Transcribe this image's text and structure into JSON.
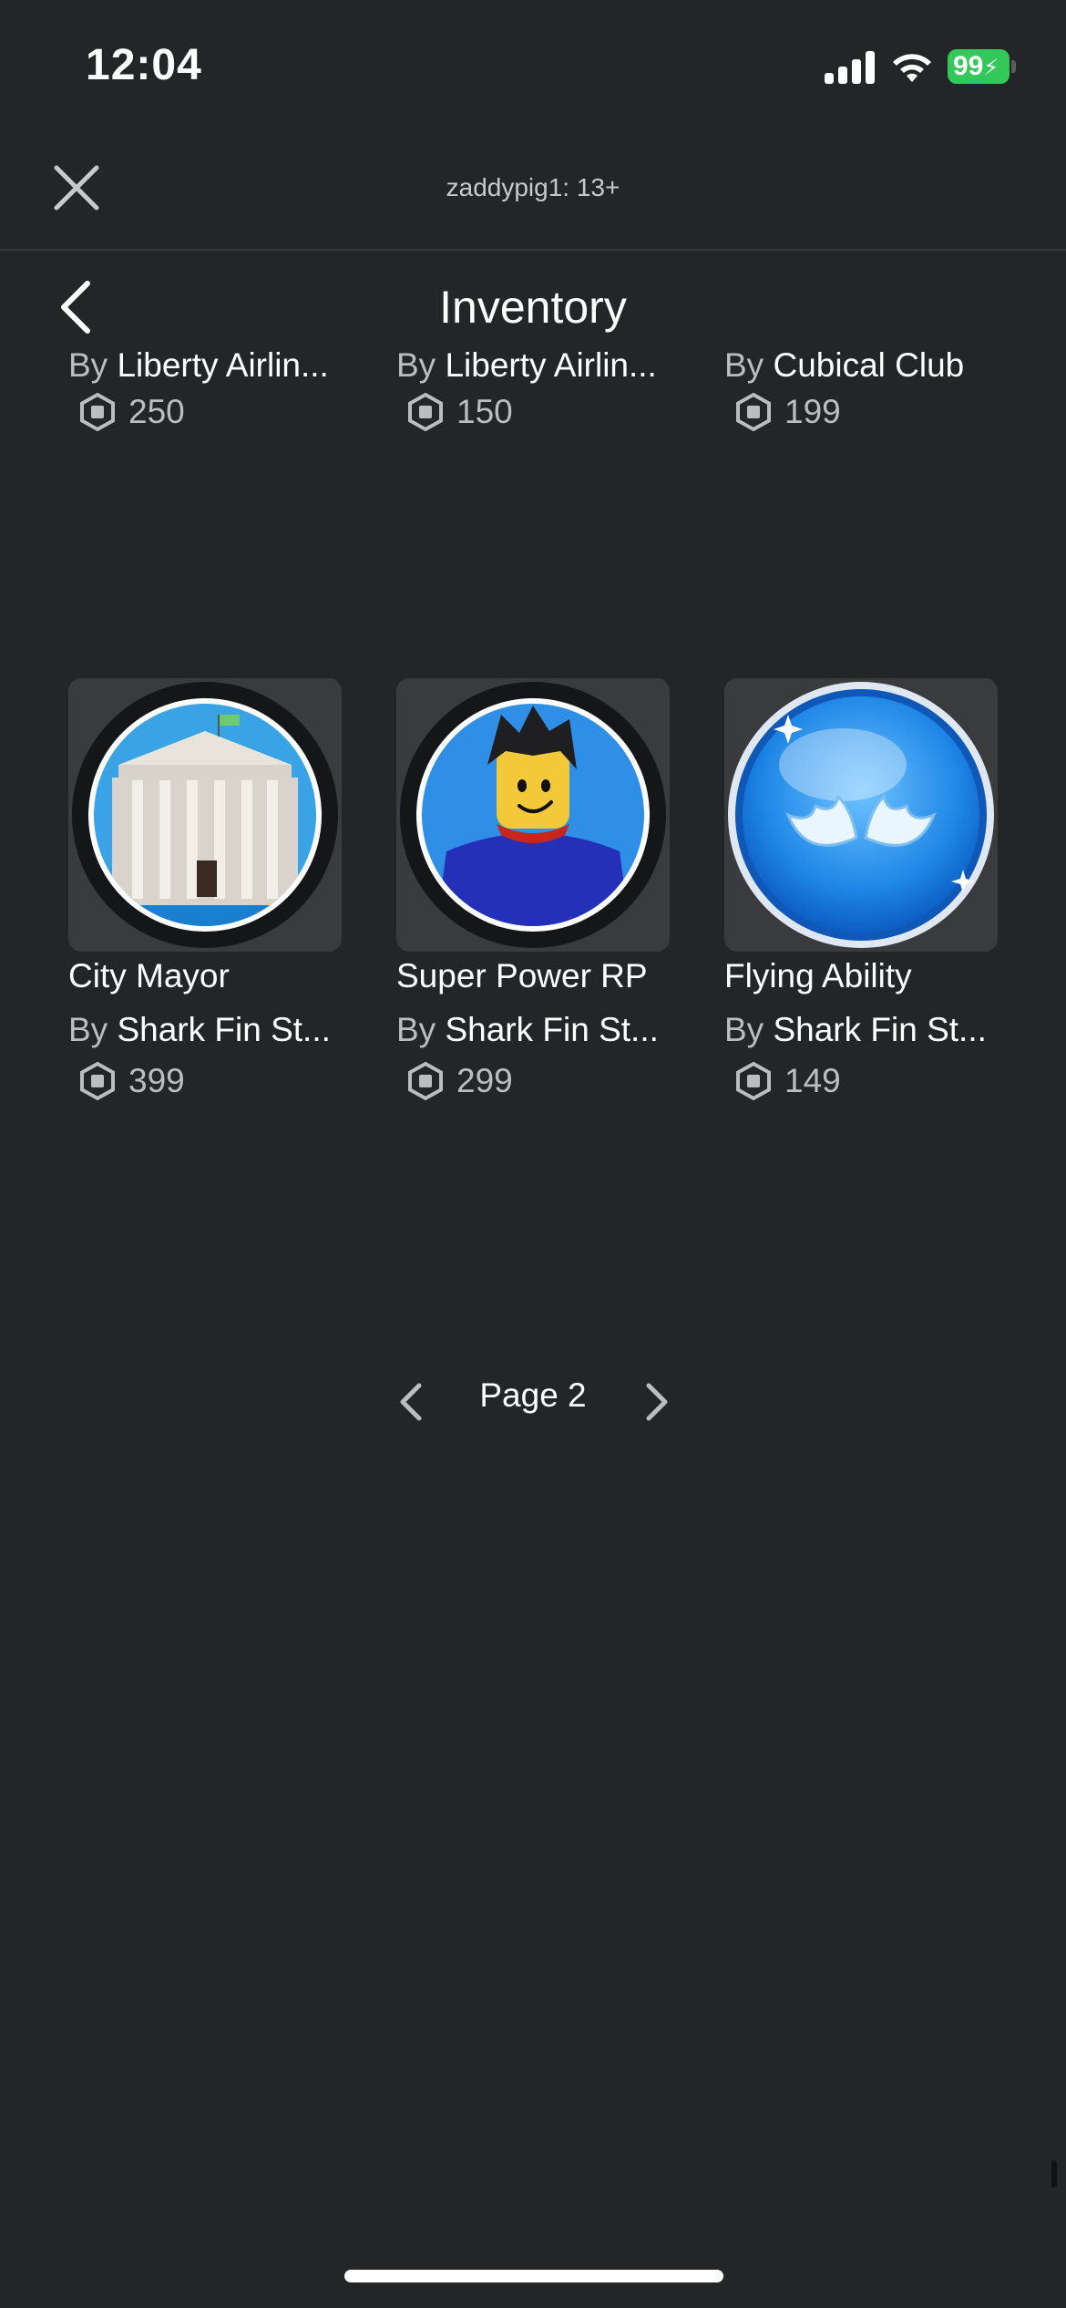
{
  "status_bar": {
    "time": "12:04",
    "battery": "99"
  },
  "header": {
    "account_label": "zaddypig1: 13+"
  },
  "nav": {
    "title": "Inventory"
  },
  "colors": {
    "background": "#232527",
    "battery": "#34c759",
    "tile": "#393b3d"
  },
  "partial_row": [
    {
      "by": "By",
      "creator": "Liberty Airlin...",
      "price": "250"
    },
    {
      "by": "By",
      "creator": "Liberty Airlin...",
      "price": "150"
    },
    {
      "by": "By",
      "creator": "Cubical Club",
      "price": "199"
    }
  ],
  "items": [
    {
      "name": "City Mayor",
      "by": "By",
      "creator": "Shark Fin St...",
      "price": "399",
      "icon": "white-house-badge-icon"
    },
    {
      "name": "Super Power RP",
      "by": "By",
      "creator": "Shark Fin St...",
      "price": "299",
      "icon": "superhero-avatar-badge-icon"
    },
    {
      "name": "Flying Ability",
      "by": "By",
      "creator": "Shark Fin St...",
      "price": "149",
      "icon": "angel-wings-badge-icon"
    }
  ],
  "pager": {
    "label": "Page 2"
  }
}
